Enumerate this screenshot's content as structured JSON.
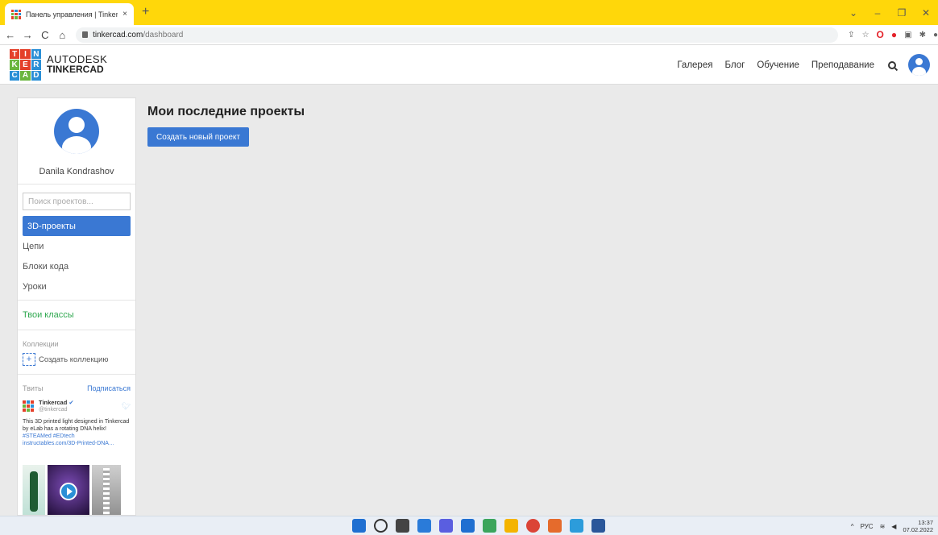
{
  "browser": {
    "tab_title": "Панель управления | Tinkercad",
    "tab_close": "×",
    "new_tab": "+",
    "url_host": "tinkercad.com",
    "url_path": "/dashboard",
    "window_controls": [
      "⌄",
      "–",
      "❐",
      "✕"
    ]
  },
  "header": {
    "logo_letters": [
      "T",
      "I",
      "N",
      "K",
      "E",
      "R",
      "C",
      "A",
      "D"
    ],
    "brand_line1": "AUTODESK",
    "brand_line2": "TINKERCAD",
    "nav": [
      "Галерея",
      "Блог",
      "Обучение",
      "Преподавание"
    ]
  },
  "sidebar": {
    "username": "Danila Kondrashov",
    "search_placeholder": "Поиск проектов...",
    "items": [
      "3D-проекты",
      "Цепи",
      "Блоки кода",
      "Уроки"
    ],
    "classes_link": "Твои классы",
    "collections_heading": "Коллекции",
    "create_collection": "Создать коллекцию",
    "tweets_heading": "Твиты",
    "subscribe": "Подписаться",
    "tweet": {
      "name": "Tinkercad",
      "handle": "@tinkercad",
      "text": "This 3D printed light designed in Tinkercad by eLab has a rotating DNA helix!",
      "hashtags": "#STEAMed #EDtech",
      "link": "instructables.com/3D-Printed-DNA…"
    }
  },
  "main": {
    "title": "Мои последние проекты",
    "create_button": "Создать новый проект"
  },
  "taskbar": {
    "lang": "РУС",
    "time": "13:37",
    "date": "07.02.2022"
  },
  "colors": {
    "accent": "#3a78d3",
    "tabstrip": "#ffd70a",
    "classes_green": "#2fa84f"
  }
}
